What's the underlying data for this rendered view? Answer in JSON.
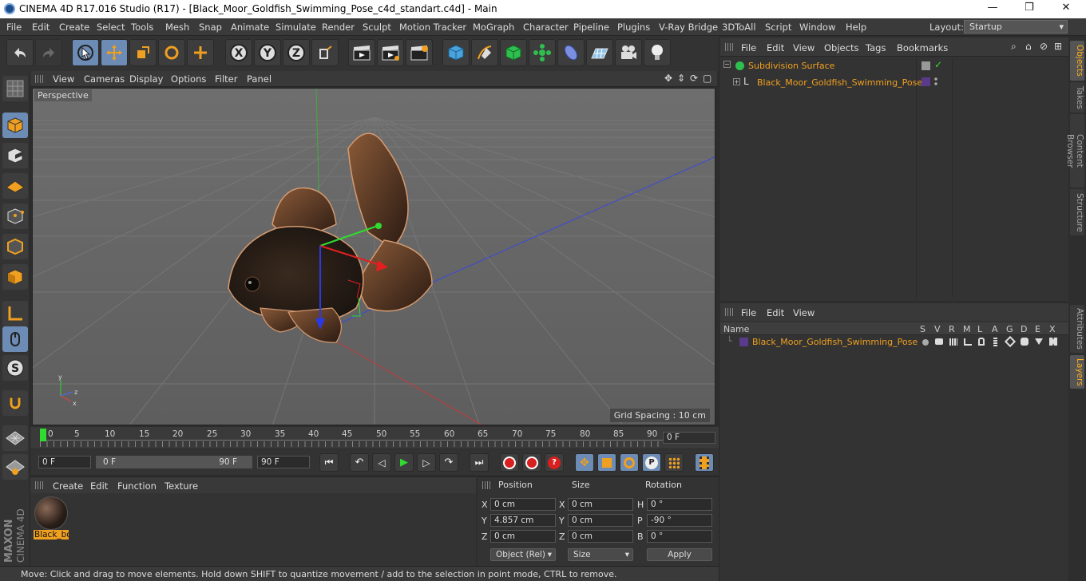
{
  "window": {
    "title": "CINEMA 4D R17.016 Studio (R17) - [Black_Moor_Goldfish_Swimming_Pose_c4d_standart.c4d] - Main",
    "minimize": "—",
    "maximize": "❒",
    "close": "✕"
  },
  "menu": [
    "File",
    "Edit",
    "Create",
    "Select",
    "Tools",
    "Mesh",
    "Snap",
    "Animate",
    "Simulate",
    "Render",
    "Sculpt",
    "Motion Tracker",
    "MoGraph",
    "Character",
    "Pipeline",
    "Plugins",
    "V-Ray Bridge",
    "3DToAll",
    "Script",
    "Window",
    "Help"
  ],
  "layout": {
    "label": "Layout:",
    "value": "Startup"
  },
  "viewport": {
    "menu": [
      "View",
      "Cameras",
      "Display",
      "Options",
      "Filter",
      "Panel"
    ],
    "label": "Perspective",
    "grid_spacing": "Grid Spacing : 10 cm"
  },
  "timeline": {
    "ticks": [
      "0",
      "5",
      "10",
      "15",
      "20",
      "25",
      "30",
      "35",
      "40",
      "45",
      "50",
      "55",
      "60",
      "65",
      "70",
      "75",
      "80",
      "85",
      "90"
    ],
    "current_frame": "0 F"
  },
  "transport": {
    "start": "0 F",
    "range_start": "0 F",
    "range_end": "90 F",
    "end": "90 F"
  },
  "material": {
    "menu": [
      "Create",
      "Edit",
      "Function",
      "Texture"
    ],
    "item_name": "Black_bo"
  },
  "coordinates": {
    "headers": {
      "position": "Position",
      "size": "Size",
      "rotation": "Rotation"
    },
    "rows": [
      {
        "axis": "X",
        "pos": "0 cm",
        "size_axis": "X",
        "size": "0 cm",
        "rot_axis": "H",
        "rot": "0 °"
      },
      {
        "axis": "Y",
        "pos": "4.857 cm",
        "size_axis": "Y",
        "size": "0 cm",
        "rot_axis": "P",
        "rot": "-90 °"
      },
      {
        "axis": "Z",
        "pos": "0 cm",
        "size_axis": "Z",
        "size": "0 cm",
        "rot_axis": "B",
        "rot": "0 °"
      }
    ],
    "mode": "Object (Rel)",
    "size_mode": "Size",
    "apply": "Apply"
  },
  "objects": {
    "menu": [
      "File",
      "Edit",
      "View",
      "Objects",
      "Tags",
      "Bookmarks"
    ],
    "items": [
      {
        "name": "Subdivision Surface"
      },
      {
        "name": "Black_Moor_Goldfish_Swimming_Pose"
      }
    ]
  },
  "layers": {
    "menu": [
      "File",
      "Edit",
      "View"
    ],
    "columns": [
      "Name",
      "S",
      "V",
      "R",
      "M",
      "L",
      "A",
      "G",
      "D",
      "E",
      "X"
    ],
    "items": [
      {
        "name": "Black_Moor_Goldfish_Swimming_Pose"
      }
    ]
  },
  "side_tabs": [
    "Objects",
    "Takes",
    "Content Browser",
    "Structure",
    "Attributes",
    "Layers"
  ],
  "status": "Move: Click and drag to move elements. Hold down SHIFT to quantize movement / add to the selection in point mode, CTRL to remove.",
  "brand": {
    "maker": "MAXON",
    "product": "CINEMA 4D"
  },
  "colors": {
    "accent": "#6c8bb5",
    "highlight": "#f0a020",
    "layer": "#5a3a8a"
  }
}
